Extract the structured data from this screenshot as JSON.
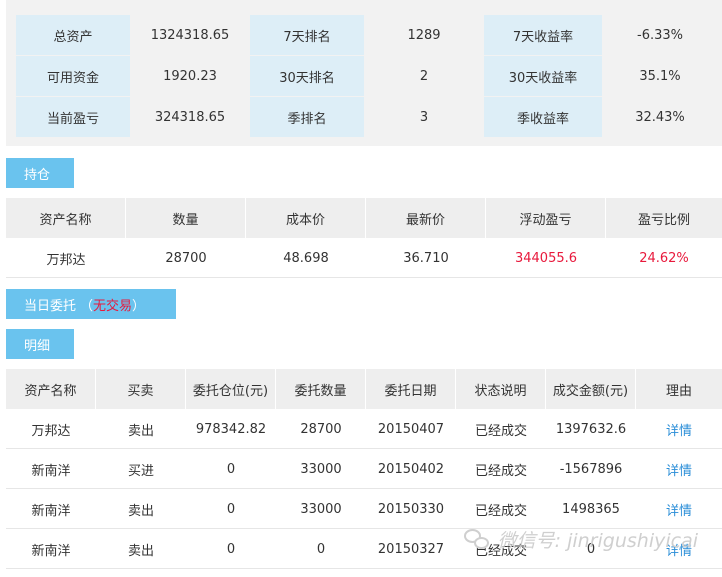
{
  "summary": {
    "rows": [
      [
        {
          "label": "总资产",
          "value": "1324318.65"
        },
        {
          "label": "7天排名",
          "value": "1289"
        },
        {
          "label": "7天收益率",
          "value": "-6.33%"
        }
      ],
      [
        {
          "label": "可用资金",
          "value": "1920.23"
        },
        {
          "label": "30天排名",
          "value": "2"
        },
        {
          "label": "30天收益率",
          "value": "35.1%"
        }
      ],
      [
        {
          "label": "当前盈亏",
          "value": "324318.65"
        },
        {
          "label": "季排名",
          "value": "3"
        },
        {
          "label": "季收益率",
          "value": "32.43%"
        }
      ]
    ]
  },
  "positions": {
    "tag": "持仓",
    "headers": [
      "资产名称",
      "数量",
      "成本价",
      "最新价",
      "浮动盈亏",
      "盈亏比例"
    ],
    "rows": [
      [
        "万邦达",
        "28700",
        "48.698",
        "36.710",
        "344055.6",
        "24.62%"
      ]
    ]
  },
  "today_orders": {
    "tag_prefix": "当日委托",
    "tag_open": "（",
    "tag_status": "无交易",
    "tag_close": "）"
  },
  "details": {
    "tag": "明细",
    "headers": [
      "资产名称",
      "买卖",
      "委托仓位(元)",
      "委托数量",
      "委托日期",
      "状态说明",
      "成交金额(元)",
      "理由"
    ],
    "rows": [
      [
        "万邦达",
        "卖出",
        "978342.82",
        "28700",
        "20150407",
        "已经成交",
        "1397632.6",
        "详情"
      ],
      [
        "新南洋",
        "买进",
        "0",
        "33000",
        "20150402",
        "已经成交",
        "-1567896",
        "详情"
      ],
      [
        "新南洋",
        "卖出",
        "0",
        "33000",
        "20150330",
        "已经成交",
        "1498365",
        "详情"
      ],
      [
        "新南洋",
        "卖出",
        "0",
        "0",
        "20150327",
        "已经成交",
        "0",
        "详情"
      ]
    ]
  },
  "watermark": {
    "icon": "wechat-icon",
    "text": "微信号: jinrigushiyicai"
  },
  "colors": {
    "accent_tag": "#6ac3ee",
    "label_cell": "#ddeef7",
    "positive_red": "#e8193c",
    "link_blue": "#2a8ed8"
  }
}
